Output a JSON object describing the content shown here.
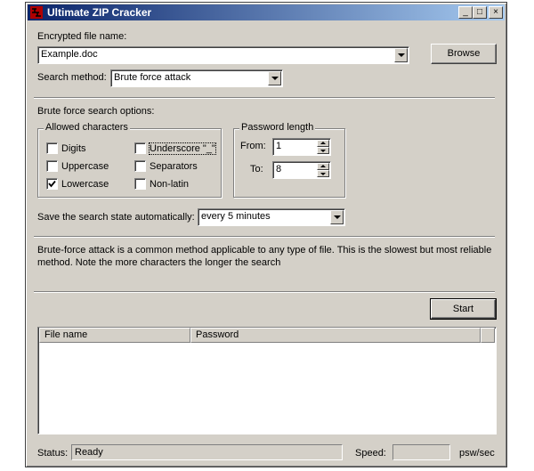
{
  "window": {
    "title": "Ultimate ZIP Cracker"
  },
  "title_buttons": {
    "minimize": "_",
    "maximize": "□",
    "close": "×"
  },
  "file": {
    "label": "Encrypted file name:",
    "value": "Example.doc",
    "browse": "Browse"
  },
  "search": {
    "label": "Search method:",
    "value": "Brute force attack"
  },
  "options": {
    "heading": "Brute force search options:",
    "allowed": {
      "legend": "Allowed characters",
      "digits": "Digits",
      "uppercase": "Uppercase",
      "lowercase": "Lowercase",
      "underscore": "Underscore \"_\"",
      "separators": "Separators",
      "nonlatin": "Non-latin"
    },
    "checked": {
      "digits": false,
      "uppercase": false,
      "lowercase": true,
      "underscore": false,
      "separators": false,
      "nonlatin": false
    },
    "length": {
      "legend": "Password length",
      "from_label": "From:",
      "from_value": "1",
      "to_label": "To:",
      "to_value": "8"
    }
  },
  "save_state": {
    "label": "Save the search state automatically:",
    "value": "every 5 minutes"
  },
  "description": "Brute-force attack is a common method applicable to any type of file. This is the slowest but most reliable method. Note the more characters the longer the search",
  "start": "Start",
  "results": {
    "columns": [
      "File name",
      "Password"
    ]
  },
  "status": {
    "label": "Status:",
    "value": "Ready",
    "speed_label": "Speed:",
    "speed_value": "",
    "unit": "psw/sec"
  },
  "colors": {
    "title_start": "#0a246a",
    "title_end": "#a6caf0",
    "face": "#d4d0c8"
  }
}
